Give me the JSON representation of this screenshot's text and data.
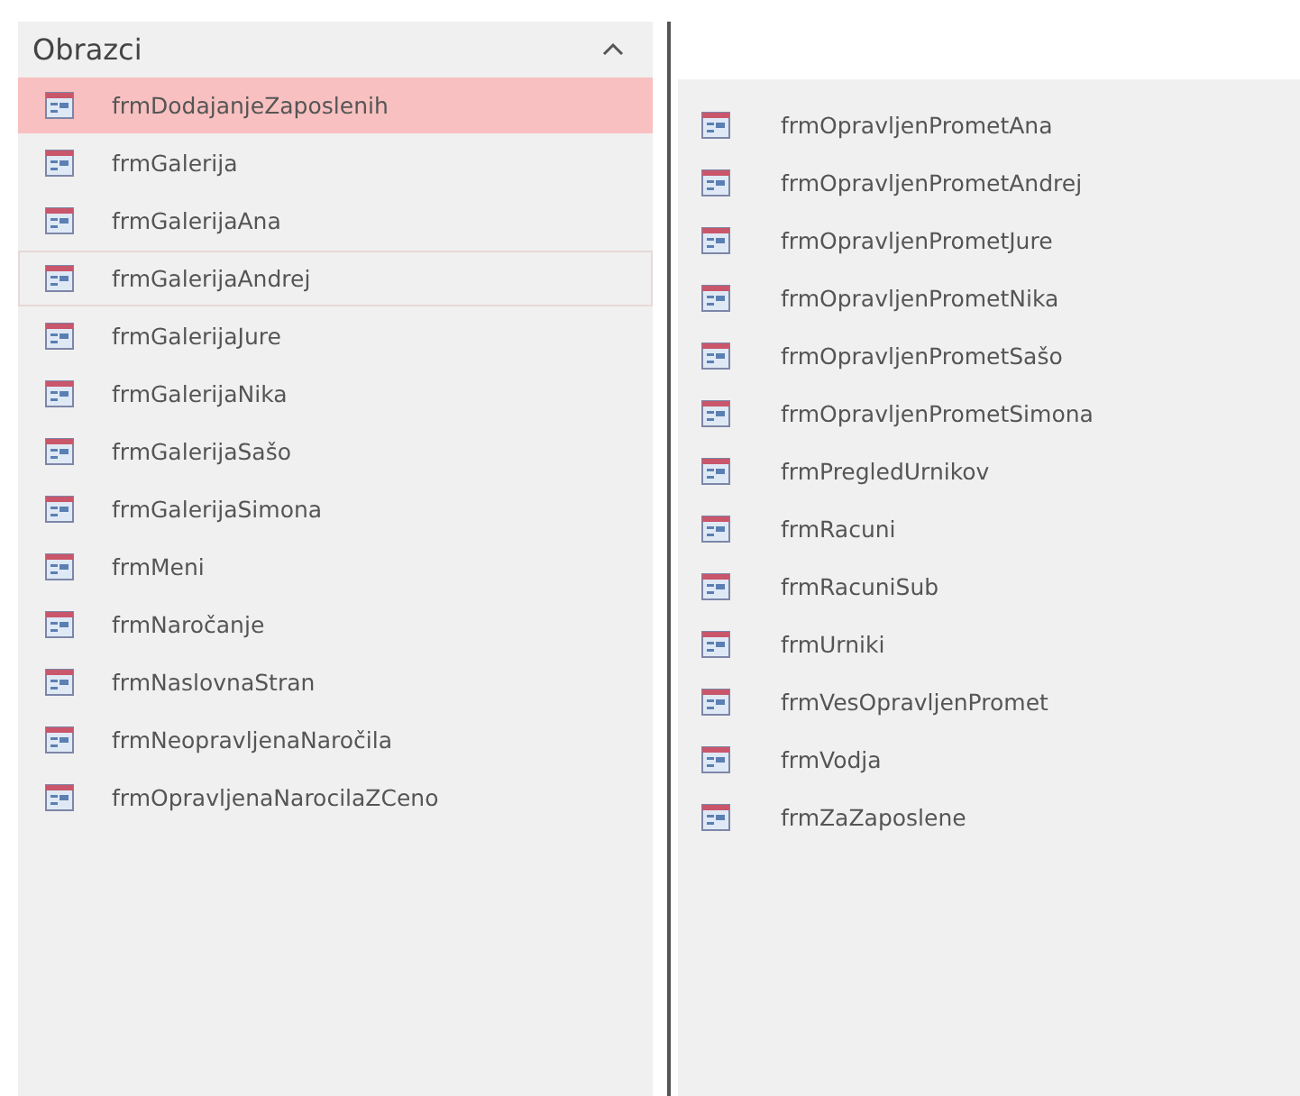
{
  "group": {
    "title": "Obrazci",
    "expanded": true
  },
  "items": [
    {
      "label": "frmDodajanjeZaposlenih",
      "selected": true,
      "hovered": false
    },
    {
      "label": "frmGalerija",
      "selected": false,
      "hovered": false
    },
    {
      "label": "frmGalerijaAna",
      "selected": false,
      "hovered": false
    },
    {
      "label": "frmGalerijaAndrej",
      "selected": false,
      "hovered": true
    },
    {
      "label": "frmGalerijaJure",
      "selected": false,
      "hovered": false
    },
    {
      "label": "frmGalerijaNika",
      "selected": false,
      "hovered": false
    },
    {
      "label": "frmGalerijaSašo",
      "selected": false,
      "hovered": false
    },
    {
      "label": "frmGalerijaSimona",
      "selected": false,
      "hovered": false
    },
    {
      "label": "frmMeni",
      "selected": false,
      "hovered": false
    },
    {
      "label": "frmNaročanje",
      "selected": false,
      "hovered": false
    },
    {
      "label": "frmNaslovnaStran",
      "selected": false,
      "hovered": false
    },
    {
      "label": "frmNeopravljenaNaročila",
      "selected": false,
      "hovered": false
    },
    {
      "label": "frmOpravljenaNarocilaZCeno",
      "selected": false,
      "hovered": false
    }
  ],
  "items_continued": [
    {
      "label": "frmOpravljenPrometAna",
      "selected": false
    },
    {
      "label": "frmOpravljenPrometAndrej",
      "selected": false
    },
    {
      "label": "frmOpravljenPrometJure",
      "selected": false
    },
    {
      "label": "frmOpravljenPrometNika",
      "selected": false
    },
    {
      "label": "frmOpravljenPrometSašo",
      "selected": false
    },
    {
      "label": "frmOpravljenPrometSimona",
      "selected": false
    },
    {
      "label": "frmPregledUrnikov",
      "selected": false
    },
    {
      "label": "frmRacuni",
      "selected": false
    },
    {
      "label": "frmRacuniSub",
      "selected": false
    },
    {
      "label": "frmUrniki",
      "selected": false
    },
    {
      "label": "frmVesOpravljenPromet",
      "selected": false
    },
    {
      "label": "frmVodja",
      "selected": false
    },
    {
      "label": "frmZaZaposlene",
      "selected": false
    }
  ]
}
